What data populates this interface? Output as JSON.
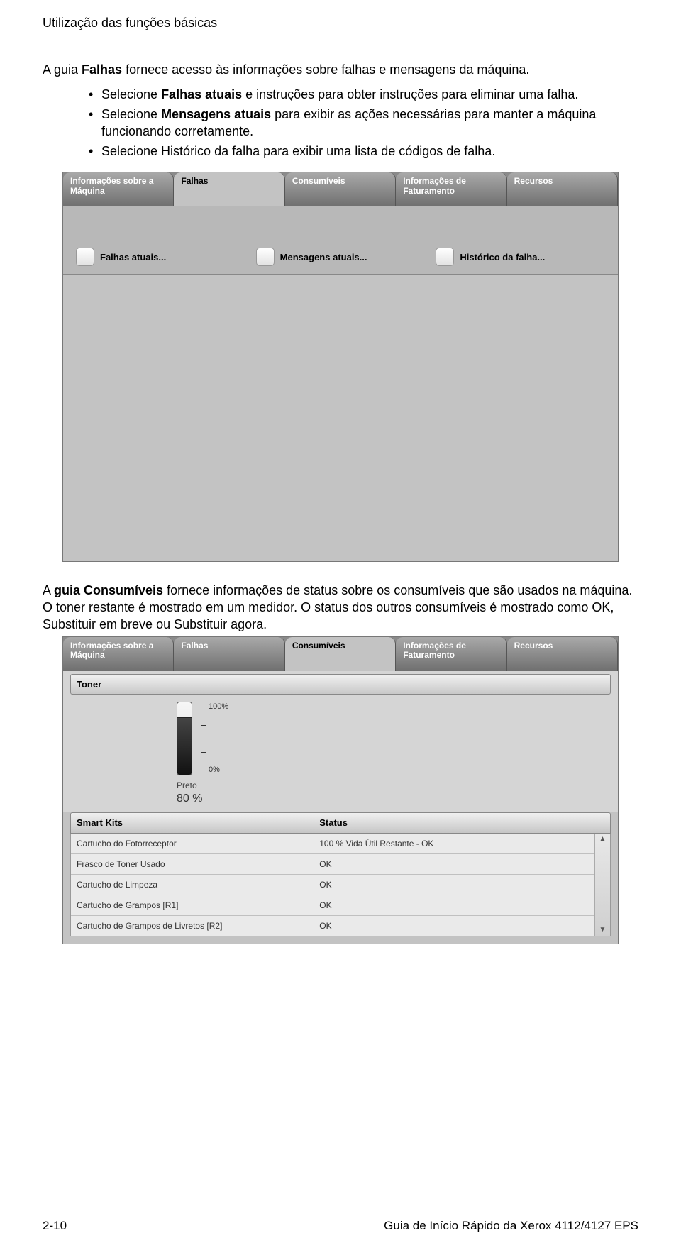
{
  "header": "Utilização das funções básicas",
  "intro_prefix": "A guia ",
  "intro_bold": "Falhas",
  "intro_suffix": " fornece acesso às informações sobre falhas e mensagens da máquina.",
  "bullets": [
    {
      "pre": "Selecione ",
      "bold": "Falhas atuais",
      "post": " e instruções para obter instruções para eliminar uma falha."
    },
    {
      "pre": "Selecione ",
      "bold": "Mensagens atuais",
      "post": " para exibir as ações necessárias para manter a máquina funcionando corretamente."
    },
    {
      "pre": "Selecione Histórico da falha para exibir uma lista de códigos de falha.",
      "bold": "",
      "post": ""
    }
  ],
  "tabs1": {
    "t0": "Informações sobre a Máquina",
    "t1": "Falhas",
    "t2": "Consumíveis",
    "t3": "Informações de Faturamento",
    "t4": "Recursos"
  },
  "toggles": {
    "a": "Falhas atuais...",
    "b": "Mensagens atuais...",
    "c": "Histórico da falha..."
  },
  "para2_prefix": "A ",
  "para2_bold": "guia Consumíveis",
  "para2_rest": " fornece informações de status sobre os consumíveis que são usados na máquina. O toner restante é mostrado em um medidor. O status dos outros consumíveis é mostrado como OK, Substituir em breve ou Substituir agora.",
  "tabs2": {
    "t0": "Informações sobre a Máquina",
    "t1": "Falhas",
    "t2": "Consumíveis",
    "t3": "Informações de Faturamento",
    "t4": "Recursos"
  },
  "toner": {
    "header": "Toner",
    "tick100": "100%",
    "tick0": "0%",
    "label": "Preto",
    "percent": "80 %"
  },
  "smartkits": {
    "col1": "Smart Kits",
    "col2": "Status",
    "rows": [
      {
        "name": "Cartucho do Fotorreceptor",
        "status": "100 % Vida Útil Restante - OK"
      },
      {
        "name": "Frasco de Toner Usado",
        "status": "OK"
      },
      {
        "name": "Cartucho de Limpeza",
        "status": "OK"
      },
      {
        "name": "Cartucho de Grampos [R1]",
        "status": "OK"
      },
      {
        "name": "Cartucho de Grampos de Livretos [R2]",
        "status": "OK"
      }
    ]
  },
  "footer": {
    "left": "2-10",
    "right": "Guia de Início Rápido da Xerox 4112/4127 EPS"
  }
}
